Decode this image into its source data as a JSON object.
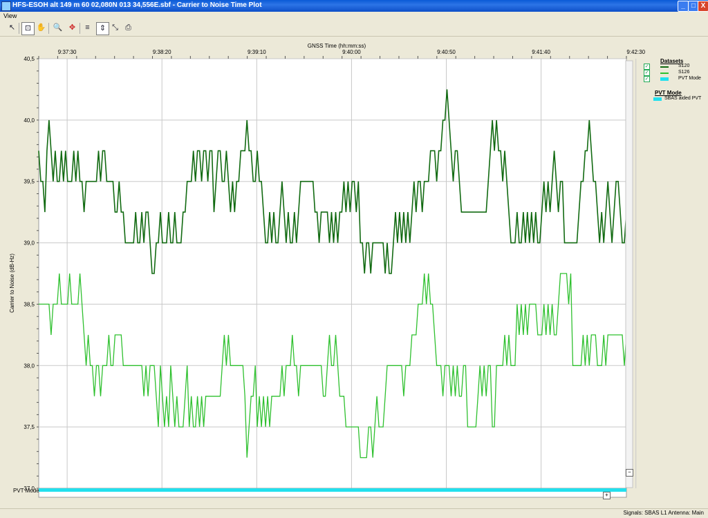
{
  "window": {
    "title": "HFS-ESOH alt 149 m 60 02,080N 013 34,556E.sbf - Carrier to Noise Time Plot",
    "buttons": {
      "minimize": "_",
      "maximize": "□",
      "close": "X"
    }
  },
  "menu": {
    "items": [
      "View"
    ]
  },
  "toolbar": {
    "icons": [
      "pointer-icon",
      "select-icon",
      "pan-icon",
      "zoom-icon",
      "fit-icon",
      "hzoom-icon",
      "vzoom-icon",
      "xy-icon",
      "print-icon"
    ]
  },
  "legend": {
    "datasets_title": "Datasets",
    "datasets": [
      {
        "label": "S120",
        "color": "#116a11"
      },
      {
        "label": "S126",
        "color": "#2ec02e"
      },
      {
        "label": "PVT Mode",
        "color": "#22e0ee"
      }
    ],
    "pvt_title": "PVT Mode",
    "pvt_items": [
      {
        "label": "SBAS aided PVT",
        "color": "#22e0ee"
      }
    ]
  },
  "pvt_row_label": "PVT Mode",
  "status": {
    "text": "Signals: SBAS L1    Antenna: Main"
  },
  "colors": {
    "s120": "#116a11",
    "s126": "#2ec02e",
    "pvt": "#22e0ee",
    "grid": "#c8c8c8"
  },
  "chart_data": {
    "type": "line",
    "title": "",
    "xlabel": "GNSS Time (hh:mm:ss)",
    "ylabel": "Carrier to Noise (dB-Hz)",
    "xticks": [
      "9:37:30",
      "9:38:20",
      "9:39:10",
      "9:40:00",
      "9:40:50",
      "9:41:40",
      "9:42:30"
    ],
    "yticks": [
      "40,5",
      "40,0",
      "39,5",
      "39,0",
      "38,5",
      "38,0",
      "37,5",
      "37,0"
    ],
    "ylim": [
      37.0,
      40.5
    ],
    "x_range_seconds": [
      0,
      310
    ],
    "grid": true,
    "legend_position": "right",
    "series": [
      {
        "name": "S120",
        "color": "#116a11",
        "values": [
          39.75,
          39.5,
          39.5,
          39.25,
          39.75,
          40.0,
          39.75,
          39.5,
          39.75,
          39.5,
          39.5,
          39.75,
          39.5,
          39.75,
          39.5,
          39.5,
          39.5,
          39.75,
          39.5,
          39.75,
          39.5,
          39.5,
          39.25,
          39.5,
          39.5,
          39.5,
          39.5,
          39.5,
          39.5,
          39.75,
          39.5,
          39.75,
          39.75,
          39.5,
          39.5,
          39.5,
          39.5,
          39.25,
          39.25,
          39.5,
          39.25,
          39.25,
          39.0,
          39.0,
          39.0,
          39.0,
          39.0,
          39.25,
          39.0,
          39.0,
          39.25,
          39.0,
          39.25,
          39.25,
          39.0,
          38.75,
          38.75,
          39.0,
          39.0,
          39.25,
          39.0,
          39.0,
          39.0,
          39.25,
          39.0,
          39.0,
          39.25,
          39.0,
          39.0,
          39.0,
          39.25,
          39.25,
          39.5,
          39.5,
          39.5,
          39.75,
          39.5,
          39.75,
          39.75,
          39.5,
          39.75,
          39.75,
          39.5,
          39.75,
          39.75,
          39.25,
          39.5,
          39.75,
          39.75,
          39.5,
          39.5,
          39.75,
          39.5,
          39.25,
          39.5,
          39.25,
          39.5,
          39.5,
          39.75,
          39.75,
          39.75,
          40.0,
          39.75,
          39.75,
          39.5,
          39.5,
          39.75,
          39.5,
          39.5,
          39.25,
          39.0,
          39.0,
          39.25,
          39.0,
          39.25,
          39.0,
          39.0,
          39.25,
          39.5,
          39.25,
          39.0,
          39.25,
          39.0,
          39.0,
          39.25,
          39.0,
          39.25,
          39.5,
          39.5,
          39.5,
          39.5,
          39.5,
          39.5,
          39.5,
          39.25,
          39.25,
          39.0,
          39.25,
          39.25,
          39.25,
          39.25,
          39.0,
          39.25,
          39.0,
          39.25,
          39.0,
          39.25,
          39.25,
          39.5,
          39.25,
          39.5,
          39.25,
          39.5,
          39.5,
          39.25,
          39.5,
          39.0,
          39.0,
          38.75,
          39.0,
          39.0,
          38.75,
          39.0,
          39.0,
          39.0,
          39.0,
          39.0,
          39.0,
          38.75,
          39.0,
          38.75,
          38.75,
          39.0,
          39.25,
          39.0,
          39.25,
          39.0,
          39.25,
          39.0,
          39.25,
          39.0,
          39.25,
          39.5,
          39.25,
          39.5,
          39.5,
          39.25,
          39.5,
          39.5,
          39.5,
          39.75,
          39.75,
          39.75,
          39.5,
          39.75,
          39.75,
          40.0,
          40.0,
          40.25,
          40.0,
          39.75,
          39.5,
          39.75,
          39.75,
          39.5,
          39.25,
          39.25,
          39.25,
          39.25,
          39.25,
          39.25,
          39.25,
          39.25,
          39.25,
          39.25,
          39.25,
          39.25,
          39.25,
          39.5,
          39.75,
          40.0,
          39.75,
          40.0,
          39.75,
          39.75,
          39.5,
          39.75,
          39.5,
          39.25,
          39.0,
          39.0,
          39.0,
          39.25,
          39.0,
          39.0,
          39.25,
          39.0,
          39.25,
          39.0,
          39.25,
          39.0,
          39.25,
          39.0,
          39.0,
          39.25,
          39.5,
          39.25,
          39.5,
          39.25,
          39.5,
          39.75,
          39.5,
          39.25,
          39.5,
          39.5,
          39.0,
          39.0,
          39.0,
          39.0,
          39.0,
          39.0,
          39.0,
          39.25,
          39.5,
          39.5,
          39.75,
          39.75,
          40.0,
          39.75,
          39.5,
          39.5,
          39.25,
          39.0,
          39.25,
          39.0,
          39.25,
          39.5,
          39.25,
          39.0,
          39.25,
          39.5,
          39.5,
          39.25,
          39.0,
          39.0,
          39.25
        ]
      },
      {
        "name": "S126",
        "color": "#2ec02e",
        "values": [
          38.5,
          38.5,
          38.5,
          38.5,
          38.5,
          38.5,
          38.25,
          38.5,
          38.5,
          38.5,
          38.75,
          38.5,
          38.5,
          38.5,
          38.5,
          38.75,
          38.5,
          38.5,
          38.5,
          38.5,
          38.75,
          38.5,
          38.25,
          38.0,
          38.25,
          38.0,
          38.0,
          37.75,
          38.0,
          38.0,
          37.75,
          38.0,
          38.0,
          38.0,
          38.25,
          38.0,
          38.0,
          38.25,
          38.25,
          38.25,
          38.25,
          38.0,
          38.0,
          38.0,
          38.0,
          38.0,
          38.0,
          38.0,
          38.0,
          38.0,
          38.0,
          37.75,
          38.0,
          37.75,
          38.0,
          38.0,
          38.0,
          37.75,
          37.5,
          38.0,
          37.75,
          37.5,
          37.75,
          37.5,
          38.0,
          37.75,
          37.5,
          37.75,
          37.5,
          37.5,
          37.5,
          37.75,
          38.0,
          37.5,
          37.75,
          37.5,
          37.5,
          37.75,
          37.5,
          37.75,
          37.5,
          37.75,
          37.75,
          37.75,
          37.75,
          37.75,
          37.75,
          37.75,
          37.75,
          38.0,
          38.25,
          38.0,
          38.25,
          38.0,
          38.0,
          38.0,
          38.0,
          38.0,
          38.0,
          38.0,
          37.75,
          37.25,
          37.5,
          37.75,
          37.75,
          38.0,
          37.5,
          37.75,
          37.5,
          37.75,
          37.5,
          37.75,
          37.5,
          37.75,
          37.75,
          37.75,
          37.75,
          37.75,
          38.0,
          37.75,
          38.0,
          38.0,
          38.0,
          38.25,
          38.0,
          38.0,
          37.75,
          38.0,
          38.0,
          38.0,
          38.0,
          38.0,
          38.0,
          38.0,
          38.0,
          38.0,
          38.0,
          38.0,
          37.75,
          37.75,
          38.0,
          38.25,
          38.0,
          38.0,
          38.25,
          38.0,
          37.75,
          37.75,
          37.75,
          37.5,
          37.5,
          37.5,
          37.5,
          37.5,
          37.5,
          37.5,
          37.25,
          37.25,
          37.25,
          37.25,
          37.5,
          37.5,
          37.25,
          37.5,
          37.75,
          37.5,
          37.5,
          37.5,
          37.75,
          38.0,
          38.0,
          38.0,
          38.0,
          38.0,
          38.0,
          38.0,
          38.0,
          37.75,
          38.0,
          38.0,
          38.0,
          38.25,
          38.25,
          38.25,
          38.5,
          38.5,
          38.5,
          38.75,
          38.5,
          38.75,
          38.5,
          38.5,
          38.25,
          38.0,
          38.0,
          38.0,
          37.75,
          38.0,
          38.0,
          38.0,
          37.75,
          38.0,
          37.75,
          38.0,
          37.75,
          37.75,
          38.0,
          38.0,
          37.5,
          37.5,
          37.5,
          37.5,
          37.5,
          37.75,
          38.0,
          37.75,
          38.0,
          37.75,
          38.0,
          38.0,
          37.5,
          37.5,
          38.0,
          38.0,
          38.0,
          38.0,
          38.25,
          38.0,
          38.25,
          38.0,
          38.0,
          38.0,
          38.5,
          38.25,
          38.5,
          38.25,
          38.5,
          38.25,
          38.5,
          38.5,
          38.5,
          38.5,
          38.25,
          38.25,
          38.25,
          38.5,
          38.25,
          38.5,
          38.25,
          38.5,
          38.25,
          38.25,
          38.5,
          38.75,
          38.75,
          38.75,
          38.75,
          38.5,
          38.75,
          38.0,
          38.0,
          38.0,
          38.0,
          38.0,
          38.25,
          38.0,
          38.25,
          38.0,
          38.25,
          38.25,
          38.25,
          38.0,
          38.0,
          38.0,
          38.25,
          38.0,
          38.25,
          38.25,
          38.25,
          38.25,
          38.25,
          38.25,
          38.25,
          38.25,
          38.0,
          38.25
        ]
      }
    ],
    "pvt_mode_bar": {
      "label": "SBAS aided PVT",
      "color": "#22e0ee"
    }
  }
}
